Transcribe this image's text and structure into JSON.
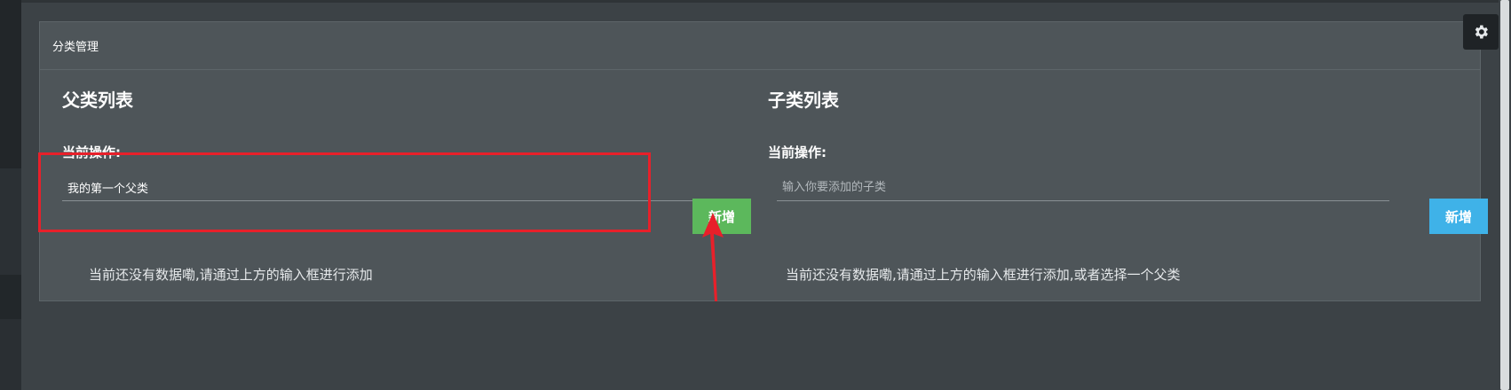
{
  "panel": {
    "title": "分类管理"
  },
  "parent": {
    "heading": "父类列表",
    "operation_label": "当前操作:",
    "input_value": "我的第一个父类",
    "add_button_label": "新增",
    "empty_text": "当前还没有数据嘞,请通过上方的输入框进行添加"
  },
  "child": {
    "heading": "子类列表",
    "operation_label": "当前操作:",
    "input_placeholder": "输入你要添加的子类",
    "add_button_label": "新增",
    "empty_text": "当前还没有数据嘞,请通过上方的输入框进行添加,或者选择一个父类"
  },
  "colors": {
    "add_parent_button": "#5cb85c",
    "add_child_button": "#3fb2e8",
    "annotation": "#e8202a"
  },
  "icons": {
    "settings": "gear-icon"
  }
}
